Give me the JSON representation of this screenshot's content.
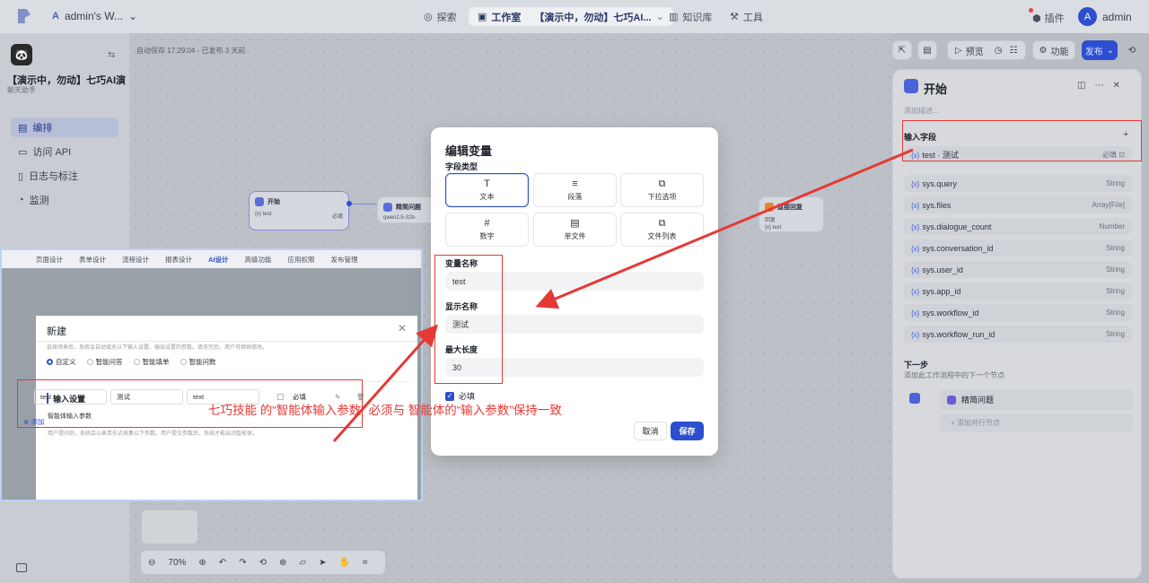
{
  "topbar": {
    "workspace": "admin's W...",
    "workspace_letter": "A",
    "nav": [
      {
        "icon": "compass-icon",
        "label": "探索"
      },
      {
        "icon": "studio-icon",
        "label": "工作室"
      },
      {
        "icon": "book-icon",
        "label": "知识库"
      },
      {
        "icon": "tool-icon",
        "label": "工具"
      }
    ],
    "current_app": "【演示中，勿动】七巧AI...",
    "plugin": "插件",
    "avatar": "A",
    "user": "admin"
  },
  "sidebar": {
    "app_title": "【演示中，勿动】七巧AI演...",
    "app_subtitle": "聊天助手",
    "items": [
      {
        "icon": "layout-icon",
        "label": "编排",
        "active": true
      },
      {
        "icon": "terminal-icon",
        "label": "访问 API"
      },
      {
        "icon": "doc-icon",
        "label": "日志与标注"
      },
      {
        "icon": "monitor-icon",
        "label": "监测"
      }
    ]
  },
  "canvas": {
    "autosave": "自动保存 17:29:04 · 已发布 3 天前",
    "start_node": {
      "title": "开始",
      "var": "test",
      "required": "必填"
    },
    "llm_node": {
      "title": "精简问题",
      "model": "qwen2.5-32b-"
    },
    "reply_node": {
      "title": "直接回复",
      "line1": "回复",
      "line2": "{x} text"
    },
    "zoom": "70%"
  },
  "actions": {
    "preview": "预览",
    "features": "功能",
    "publish": "发布"
  },
  "right_panel": {
    "title": "开始",
    "desc_placeholder": "添加描述...",
    "input_fields_label": "输入字段",
    "input_var": {
      "name": "test · 测试",
      "required": "必填"
    },
    "sys_vars": [
      {
        "name": "sys.query",
        "type": "String"
      },
      {
        "name": "sys.files",
        "type": "Array[File]"
      },
      {
        "name": "sys.dialogue_count",
        "type": "Number"
      },
      {
        "name": "sys.conversation_id",
        "type": "String"
      },
      {
        "name": "sys.user_id",
        "type": "String"
      },
      {
        "name": "sys.app_id",
        "type": "String"
      },
      {
        "name": "sys.workflow_id",
        "type": "String"
      },
      {
        "name": "sys.workflow_run_id",
        "type": "String"
      }
    ],
    "next_step_label": "下一步",
    "next_step_desc": "添加此工作流程中的下一个节点",
    "next_node": "精简问题",
    "add_parallel": "添加并行节点"
  },
  "overlay_shot": {
    "tabs": [
      "页面设计",
      "表单设计",
      "流程设计",
      "报表设计",
      "AI设计",
      "高级功能",
      "应用权限",
      "发布管理"
    ],
    "active_tab": "AI设计",
    "dialog_title": "新建",
    "hint": "选择场景后，系统会自动填充以下输入设置、输出设置的参数。填充完后，用户可继续修改。",
    "radios": [
      "自定义",
      "智能问答",
      "智能填单",
      "智能问数"
    ],
    "section_title": "输入设置",
    "section_sub": "智能体输入参数",
    "section_hint": "用户提问后，系统会以表单形式收集以下参数。用户提交参数后，系统才能启动智能体。",
    "param": {
      "name": "test",
      "display": "测试",
      "type": "text",
      "required": "必填"
    },
    "add": "添加"
  },
  "modal": {
    "title": "编辑变量",
    "field_type_label": "字段类型",
    "types": [
      {
        "icon": "text-icon",
        "glyph": "T",
        "label": "文本",
        "selected": true
      },
      {
        "icon": "paragraph-icon",
        "glyph": "≡",
        "label": "段落"
      },
      {
        "icon": "select-icon",
        "glyph": "⧉",
        "label": "下拉选项"
      },
      {
        "icon": "number-icon",
        "glyph": "#",
        "label": "数字"
      },
      {
        "icon": "file-icon",
        "glyph": "▤",
        "label": "单文件"
      },
      {
        "icon": "files-icon",
        "glyph": "⧉",
        "label": "文件列表"
      }
    ],
    "var_name_label": "变量名称",
    "var_name": "test",
    "display_name_label": "显示名称",
    "display_name": "测试",
    "max_len_label": "最大长度",
    "max_len": "30",
    "required_label": "必填",
    "cancel": "取消",
    "save": "保存"
  },
  "annotation": "七巧技能 的“智能体输入参数” 必须与 智能体的“输入参数”保持一致",
  "colors": {
    "accent": "#2d4fcf",
    "annotation_red": "#e53935"
  }
}
